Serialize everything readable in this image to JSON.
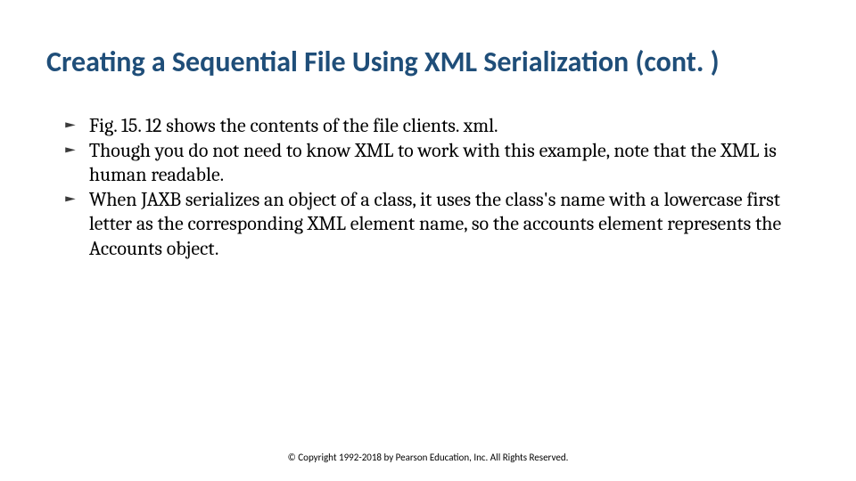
{
  "slide": {
    "title": "Creating a Sequential File Using XML Serialization (cont. )",
    "bullets": [
      "Fig. 15. 12 shows the contents of the file clients. xml.",
      "Though you do not need to know XML to work with this example, note that the XML is human readable.",
      " When JAXB serializes an object of a class, it uses the class's name with a lowercase first letter as the corresponding XML element name, so the accounts element represents the Accounts object."
    ],
    "footer": "© Copyright 1992-2018 by Pearson Education, Inc. All Rights Reserved."
  },
  "glyph": "⯈"
}
